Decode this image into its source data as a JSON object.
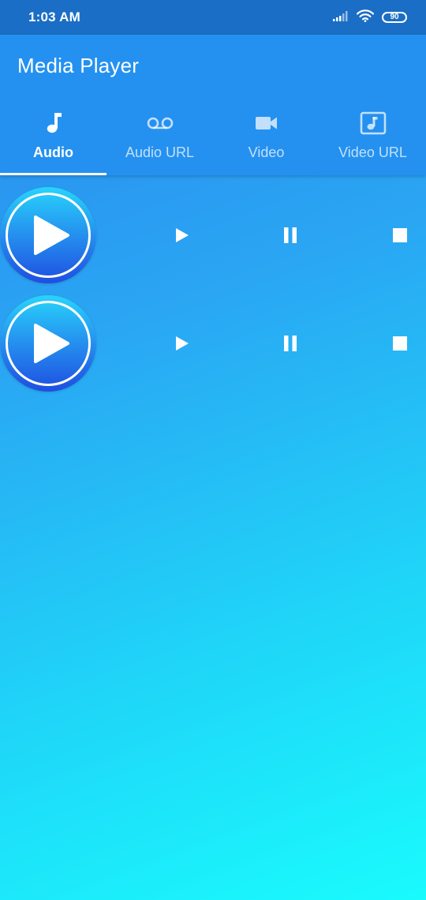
{
  "status_bar": {
    "time": "1:03 AM",
    "battery": "90",
    "icons": [
      "signal-icon",
      "wifi-icon",
      "battery-icon"
    ]
  },
  "app_bar": {
    "title": "Media Player",
    "color": "#2491f0"
  },
  "tabs": [
    {
      "label": "Audio",
      "icon": "music-note-icon",
      "selected": true
    },
    {
      "label": "Audio URL",
      "icon": "voicemail-icon",
      "selected": false
    },
    {
      "label": "Video",
      "icon": "videocam-icon",
      "selected": false
    },
    {
      "label": "Video URL",
      "icon": "music-video-icon",
      "selected": false
    }
  ],
  "players": [
    {
      "controls": [
        "play-circle-icon",
        "play-icon",
        "pause-icon",
        "stop-icon"
      ]
    },
    {
      "controls": [
        "play-circle-icon",
        "play-icon",
        "pause-icon",
        "stop-icon"
      ]
    }
  ],
  "colors": {
    "status_bar": "#1b6ec5",
    "gradient_top": "#2a88ee",
    "gradient_bottom": "#19fbfd"
  }
}
